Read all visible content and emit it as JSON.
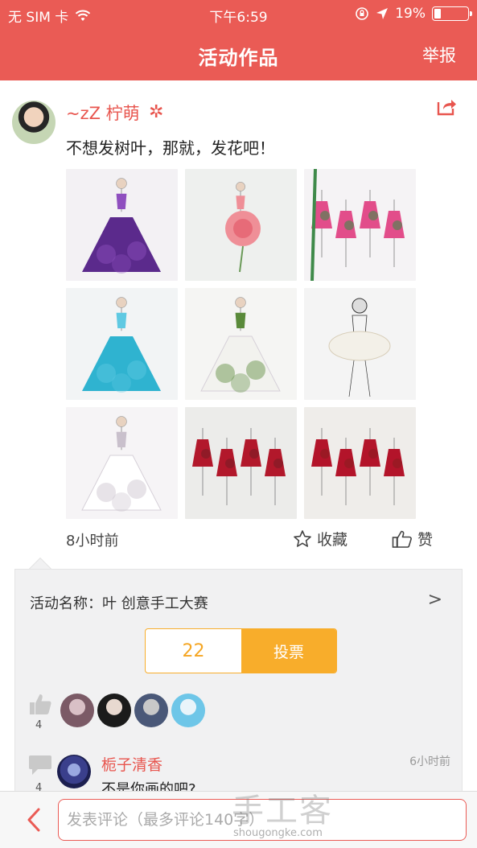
{
  "status_bar": {
    "carrier": "无 SIM 卡",
    "time": "下午6:59",
    "battery": "19%",
    "battery_level": 0.19,
    "icons": [
      "wifi-icon",
      "orientation-lock-icon",
      "location-arrow-icon",
      "battery-icon"
    ]
  },
  "nav": {
    "title": "活动作品",
    "report": "举报"
  },
  "post": {
    "username": "~zZ 柠萌",
    "text": "不想发树叶，那就，发花吧！",
    "time_ago": "8小时前",
    "collect": "收藏",
    "like": "赞",
    "photos": [
      {
        "bg": "#f3f1f4",
        "color": "#5b2a8c",
        "accent": "#8f4fbf",
        "kind": "purple-dress"
      },
      {
        "bg": "#eef0ee",
        "color": "#ef8f97",
        "accent": "#6a9a58",
        "kind": "pink-rose"
      },
      {
        "bg": "#f5f3f5",
        "color": "#e24d8a",
        "accent": "#3f8a4a",
        "kind": "pink-dresses"
      },
      {
        "bg": "#f2f4f5",
        "color": "#2fb3d0",
        "accent": "#5fc9e2",
        "kind": "blue-gown"
      },
      {
        "bg": "#f5f5f3",
        "color": "#f2f2ee",
        "accent": "#5a8a3a",
        "kind": "white-flower"
      },
      {
        "bg": "#f4f4f4",
        "color": "#f3f0e8",
        "accent": "#333333",
        "kind": "white-skirt"
      },
      {
        "bg": "#f6f4f6",
        "color": "#ffffff",
        "accent": "#c9c0cc",
        "kind": "white-ballgown"
      },
      {
        "bg": "#ececea",
        "color": "#b2182b",
        "accent": "#7a1c24",
        "kind": "red-dresses"
      },
      {
        "bg": "#efedea",
        "color": "#b3142a",
        "accent": "#8a1c22",
        "kind": "red-dresses-2"
      }
    ]
  },
  "activity": {
    "name": "活动名称：叶 创意手工大赛",
    "chevron": ">",
    "votes": "22",
    "vote_button": "投票",
    "likes_count": "4",
    "comments_count": "4",
    "voters": [
      {
        "c1": "#d9c0c6",
        "c2": "#7b5a66"
      },
      {
        "c1": "#e8d9d0",
        "c2": "#1b1b1b"
      },
      {
        "c1": "#c8c8c8",
        "c2": "#4a5878"
      },
      {
        "c1": "#e9f4fa",
        "c2": "#6ec6e8"
      }
    ],
    "comment": {
      "name": "栀子清香",
      "time": "6小时前",
      "text": "不是你画的吧?"
    }
  },
  "bottom": {
    "placeholder": "发表评论（最多评论140字）"
  },
  "watermark": {
    "text": "手工客",
    "url": "shougongke.com"
  },
  "colors": {
    "brand": "#ea5b55",
    "vote": "#f8ad2b"
  }
}
